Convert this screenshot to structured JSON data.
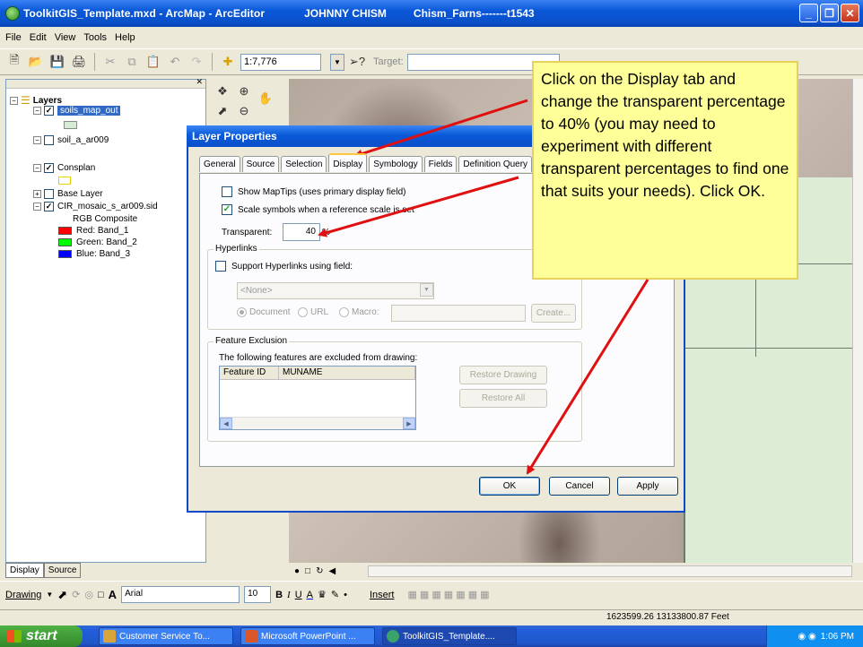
{
  "window": {
    "title": "ToolkitGIS_Template.mxd - ArcMap - ArcEditor",
    "user": "JOHNNY CHISM",
    "project": "Chism_Farns-------t1543",
    "buttons": [
      "_",
      "❐",
      "✕"
    ]
  },
  "menu": [
    "File",
    "Edit",
    "View",
    "Tools",
    "Help"
  ],
  "toolbar": {
    "scale": "1:7,776",
    "target_label": "Target:"
  },
  "toc": {
    "root": "Layers",
    "layers": [
      {
        "name": "soils_map_out",
        "checked": true,
        "selected": true
      },
      {
        "name": "soil_a_ar009",
        "checked": false
      },
      {
        "name": "Consplan",
        "checked": true
      },
      {
        "name": "Base Layer",
        "checked": false
      },
      {
        "name": "CIR_mosaic_s_ar009.sid",
        "checked": true
      }
    ],
    "rgb_label": "RGB Composite",
    "bands": [
      {
        "label": "Red:  Band_1",
        "color": "#ff0000"
      },
      {
        "label": "Green: Band_2",
        "color": "#00ff00"
      },
      {
        "label": "Blue:  Band_3",
        "color": "#0000ff"
      }
    ],
    "tabs": [
      "Display",
      "Source"
    ]
  },
  "dialog": {
    "title": "Layer Properties",
    "tabs": [
      "General",
      "Source",
      "Selection",
      "Display",
      "Symbology",
      "Fields",
      "Definition Query"
    ],
    "active_tab": "Display",
    "show_maptips": "Show MapTips (uses primary display field)",
    "scale_symbols": "Scale symbols when a reference scale is set",
    "transparent_label": "Transparent:",
    "transparent_value": "40",
    "transparent_unit": "%",
    "hyperlinks_group": "Hyperlinks",
    "support_hyperlinks": "Support Hyperlinks using field:",
    "field_select": "<None>",
    "radio_document": "Document",
    "radio_url": "URL",
    "radio_macro": "Macro:",
    "create_btn": "Create...",
    "exclusion_group": "Feature Exclusion",
    "exclusion_text": "The following features are excluded from drawing:",
    "col_feature_id": "Feature ID",
    "col_muname": "MUNAME",
    "restore_drawing": "Restore Drawing",
    "restore_all": "Restore All",
    "ok": "OK",
    "cancel": "Cancel",
    "apply": "Apply"
  },
  "callout": {
    "text": "Click on the Display tab and change the transparent percentage to 40% (you may need to experiment with different transparent percentages to find one that suits your needs). Click OK."
  },
  "drawing_toolbar": {
    "drawing": "Drawing",
    "font": "Arial",
    "size": "10",
    "insert": "Insert"
  },
  "status": {
    "coords": "1623599.26  13133800.87 Feet"
  },
  "taskbar": {
    "start": "start",
    "tasks": [
      "Customer Service To...",
      "Microsoft PowerPoint ...",
      "ToolkitGIS_Template...."
    ],
    "time": "1:06 PM"
  },
  "colors": {
    "title_bar": "#0a58d8",
    "callout_bg": "#ffff99",
    "arrow": "#e01010"
  }
}
